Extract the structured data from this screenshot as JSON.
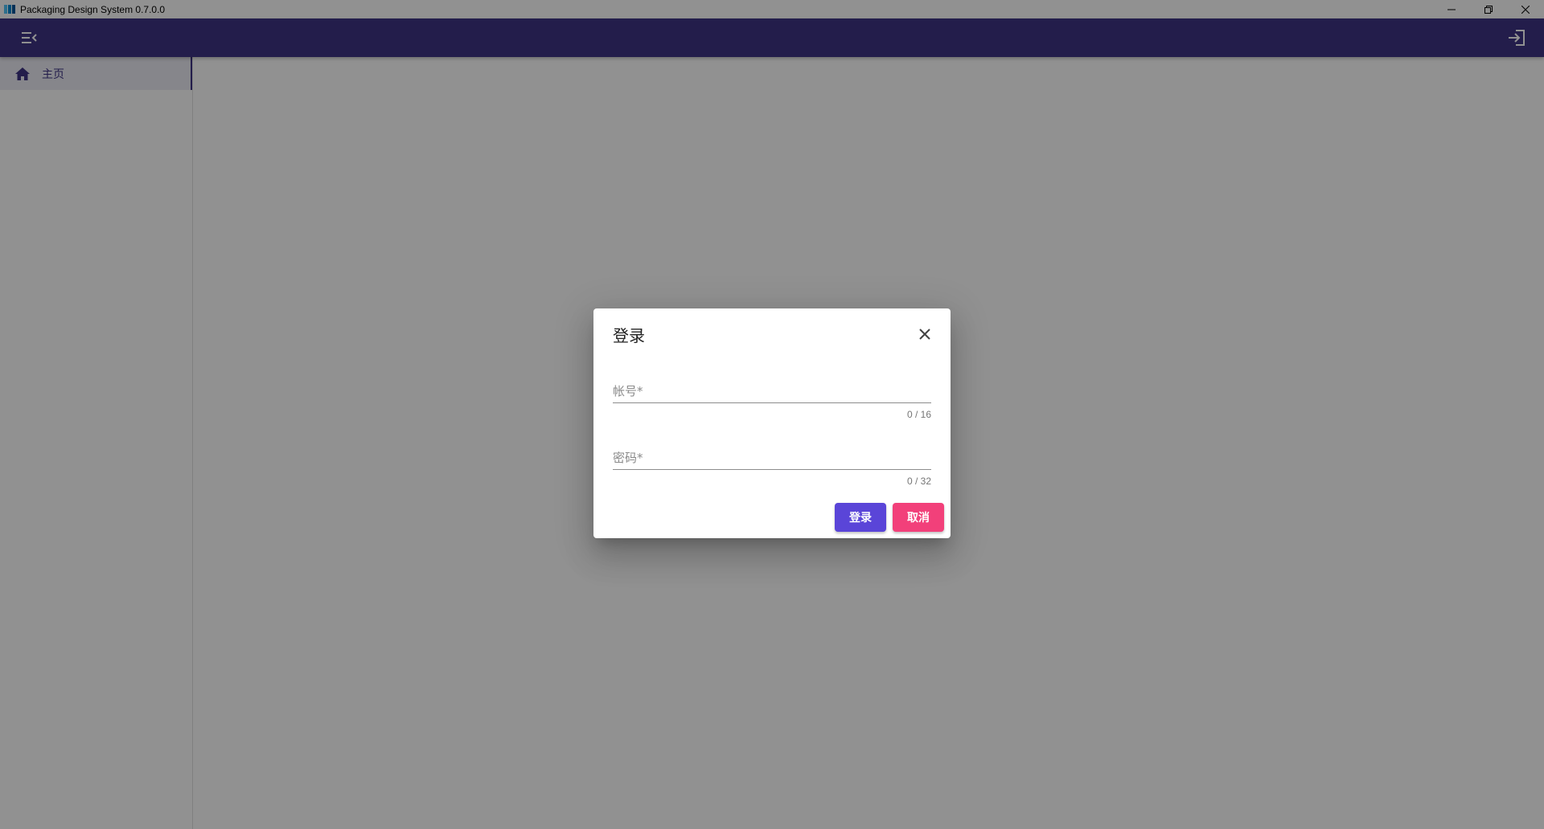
{
  "window": {
    "title": "Packaging Design System 0.7.0.0",
    "controls": [
      "minimize-icon",
      "restore-icon",
      "close-icon"
    ]
  },
  "appbar": {
    "color": "#3f3385",
    "menu_icon": "menu-collapse-icon",
    "login_icon": "login-icon"
  },
  "sidebar": {
    "items": [
      {
        "label": "主页",
        "icon": "home-icon",
        "active": true
      }
    ]
  },
  "dialog": {
    "title": "登录",
    "close_icon": "close-icon",
    "username": {
      "placeholder": "帐号*",
      "value": "",
      "counter": "0 / 16"
    },
    "password": {
      "placeholder": "密码*",
      "value": "",
      "counter": "0 / 32"
    },
    "login_label": "登录",
    "cancel_label": "取消",
    "colors": {
      "login": "#5a45d8",
      "cancel": "#f2407a"
    }
  }
}
